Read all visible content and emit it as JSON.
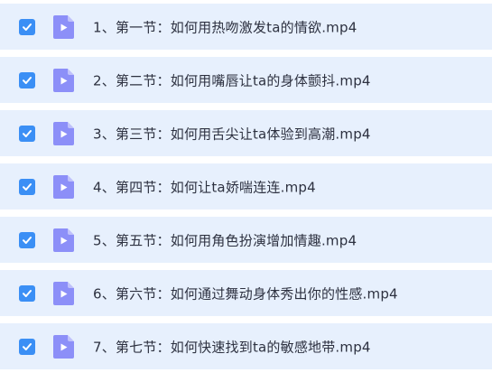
{
  "colors": {
    "row_background": "#e7f0fd",
    "checkbox": "#3b8ff5",
    "video_icon": "#8c8ff8",
    "text": "#2d3140"
  },
  "files": [
    {
      "name": "1、第一节：如何用热吻激发ta的情欲.mp4",
      "checked": true,
      "icon": "video-file-icon"
    },
    {
      "name": "2、第二节：如何用嘴唇让ta的身体颤抖.mp4",
      "checked": true,
      "icon": "video-file-icon"
    },
    {
      "name": "3、第三节：如何用舌尖让ta体验到高潮.mp4",
      "checked": true,
      "icon": "video-file-icon"
    },
    {
      "name": "4、第四节：如何让ta娇喘连连.mp4",
      "checked": true,
      "icon": "video-file-icon"
    },
    {
      "name": "5、第五节：如何用角色扮演增加情趣.mp4",
      "checked": true,
      "icon": "video-file-icon"
    },
    {
      "name": "6、第六节：如何通过舞动身体秀出你的性感.mp4",
      "checked": true,
      "icon": "video-file-icon"
    },
    {
      "name": "7、第七节：如何快速找到ta的敏感地带.mp4",
      "checked": true,
      "icon": "video-file-icon"
    }
  ]
}
